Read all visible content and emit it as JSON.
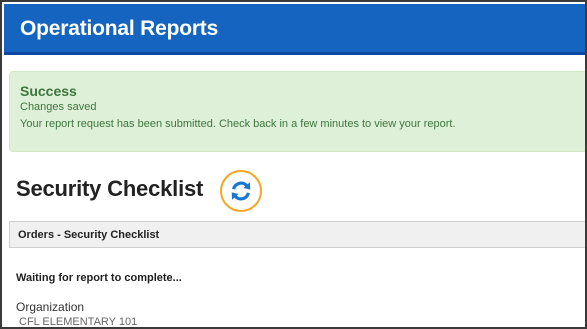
{
  "header": {
    "title": "Operational Reports"
  },
  "alert": {
    "title": "Success",
    "line1": "Changes saved",
    "line2": "Your report request has been submitted. Check back in a few minutes to view your report."
  },
  "page": {
    "title": "Security Checklist",
    "refresh_icon": "refresh-icon"
  },
  "section": {
    "label": "Orders - Security Checklist"
  },
  "status": {
    "text": "Waiting for report to complete..."
  },
  "organization": {
    "label": "Organization",
    "value": "CFL ELEMENTARY 101"
  },
  "colors": {
    "header_bg": "#1565c0",
    "success_bg": "#dff0d8",
    "success_text": "#3c763d",
    "highlight": "#f5a623",
    "icon_blue": "#1976d2"
  }
}
